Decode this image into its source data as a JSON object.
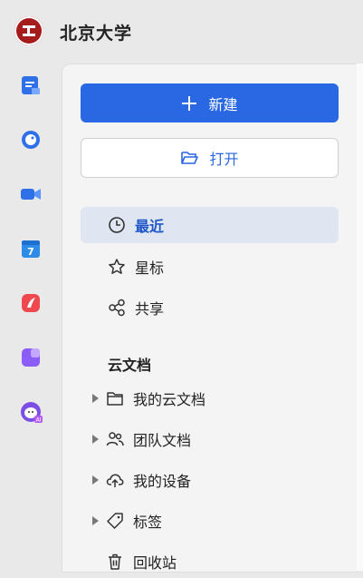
{
  "header": {
    "org_name": "北京大学"
  },
  "rail": {
    "items": [
      {
        "name": "docs-app-icon",
        "color": "#2f6fe8"
      },
      {
        "name": "chat-app-icon",
        "color": "#2f6fe8"
      },
      {
        "name": "meeting-app-icon",
        "color": "#2f6fe8"
      },
      {
        "name": "calendar-app-icon",
        "color": "#2f8be8"
      },
      {
        "name": "notes-app-icon",
        "color": "#f0484f"
      },
      {
        "name": "workspace-app-icon",
        "color": "#8b5cf6"
      },
      {
        "name": "ai-assistant-icon",
        "color": "#7c4ee6"
      }
    ]
  },
  "panel": {
    "new_button": "新建",
    "open_button": "打开",
    "nav": [
      {
        "label": "最近",
        "icon": "clock-icon",
        "active": true
      },
      {
        "label": "星标",
        "icon": "star-icon",
        "active": false
      },
      {
        "label": "共享",
        "icon": "share-icon",
        "active": false
      }
    ],
    "section_title": "云文档",
    "tree": [
      {
        "label": "我的云文档",
        "icon": "folder-icon",
        "has_caret": true
      },
      {
        "label": "团队文档",
        "icon": "team-icon",
        "has_caret": true
      },
      {
        "label": "我的设备",
        "icon": "cloud-upload-icon",
        "has_caret": true
      },
      {
        "label": "标签",
        "icon": "tag-icon",
        "has_caret": true
      },
      {
        "label": "回收站",
        "icon": "trash-icon",
        "has_caret": false
      }
    ]
  },
  "colors": {
    "accent": "#2a67e3",
    "active_bg": "#e0e6f1",
    "panel_bg": "#f4f4f5"
  }
}
